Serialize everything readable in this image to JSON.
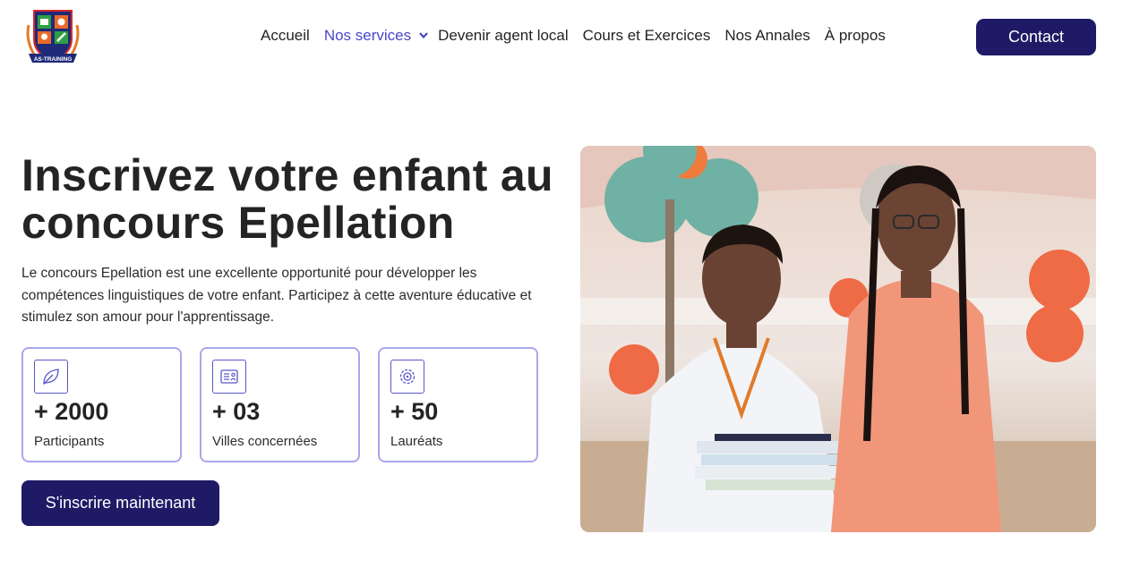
{
  "header": {
    "logo_text": "AS-TRAINING",
    "nav": [
      {
        "label": "Accueil",
        "active": false
      },
      {
        "label": "Nos services",
        "active": true,
        "has_dropdown": true
      },
      {
        "label": "Devenir agent local",
        "active": false
      },
      {
        "label": "Cours et Exercices",
        "active": false
      },
      {
        "label": "Nos Annales",
        "active": false
      },
      {
        "label": "À propos",
        "active": false
      }
    ],
    "contact_label": "Contact"
  },
  "hero": {
    "title_line1": "Inscrivez votre enfant au",
    "title_line2": "concours Epellation",
    "description": "Le concours Epellation est une excellente opportunité pour développer les compétences linguistiques de votre enfant. Participez à cette aventure éducative et stimulez son amour pour l'apprentissage.",
    "stats": [
      {
        "icon": "leaf-icon",
        "value": "+ 2000",
        "label": "Participants"
      },
      {
        "icon": "id-card-icon",
        "value": "+ 03",
        "label": "Villes concernées"
      },
      {
        "icon": "gear-icon",
        "value": "+ 50",
        "label": "Lauréats"
      }
    ],
    "cta_label": "S'inscrire maintenant"
  },
  "colors": {
    "brand_dark": "#1e1a66",
    "accent": "#4a46c8",
    "stat_border": "#a9a6ee"
  }
}
